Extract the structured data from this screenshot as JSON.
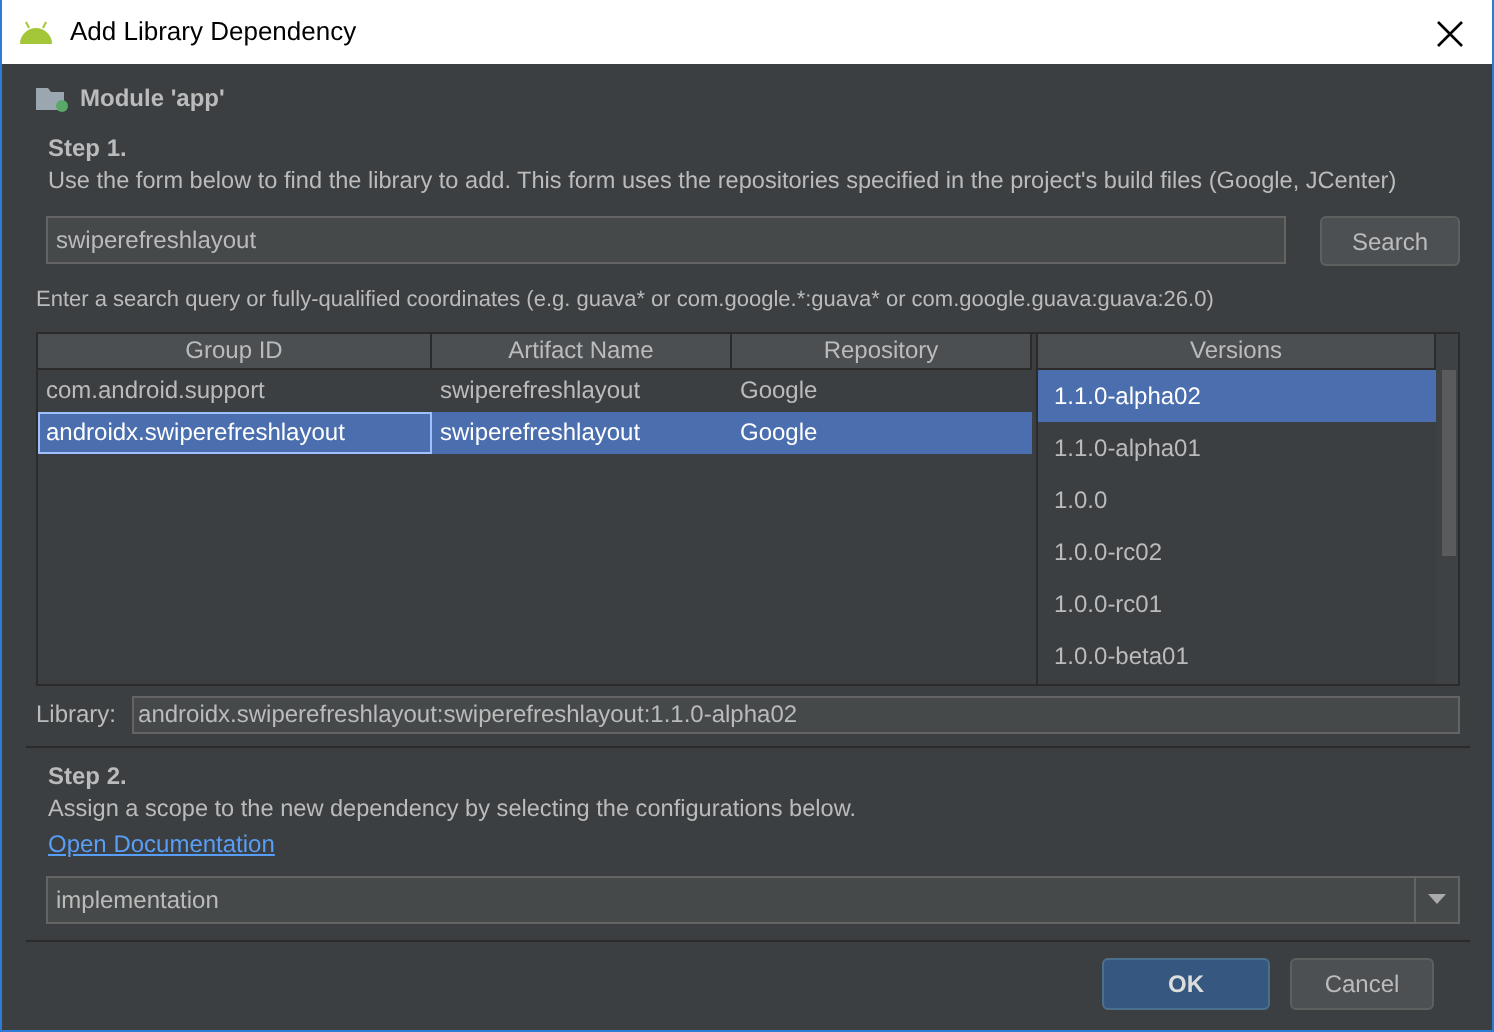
{
  "window": {
    "title": "Add Library Dependency"
  },
  "module": {
    "label": "Module 'app'"
  },
  "step1": {
    "heading": "Step 1.",
    "description": "Use the form below to find the library to add. This form uses the repositories specified in the project's build files (Google, JCenter)"
  },
  "search": {
    "value": "swiperefreshlayout",
    "button": "Search",
    "hint": "Enter a search query or fully-qualified coordinates (e.g. guava* or com.google.*:guava* or com.google.guava:guava:26.0)"
  },
  "table": {
    "columns": [
      "Group ID",
      "Artifact Name",
      "Repository"
    ],
    "rows": [
      {
        "cells": [
          "com.android.support",
          "swiperefreshlayout",
          "Google"
        ],
        "selected": false
      },
      {
        "cells": [
          "androidx.swiperefreshlayout",
          "swiperefreshlayout",
          "Google"
        ],
        "selected": true
      }
    ]
  },
  "versions": {
    "heading": "Versions",
    "items": [
      {
        "label": "1.1.0-alpha02",
        "selected": true
      },
      {
        "label": "1.1.0-alpha01",
        "selected": false
      },
      {
        "label": "1.0.0",
        "selected": false
      },
      {
        "label": "1.0.0-rc02",
        "selected": false
      },
      {
        "label": "1.0.0-rc01",
        "selected": false
      },
      {
        "label": "1.0.0-beta01",
        "selected": false
      }
    ]
  },
  "library": {
    "label": "Library:",
    "value": "androidx.swiperefreshlayout:swiperefreshlayout:1.1.0-alpha02"
  },
  "step2": {
    "heading": "Step 2.",
    "description": "Assign a scope to the new dependency by selecting the configurations below.",
    "link": "Open Documentation"
  },
  "scope": {
    "value": "implementation"
  },
  "buttons": [
    {
      "label": "OK",
      "kind": "primary"
    },
    {
      "label": "Cancel",
      "kind": "secondary"
    }
  ]
}
